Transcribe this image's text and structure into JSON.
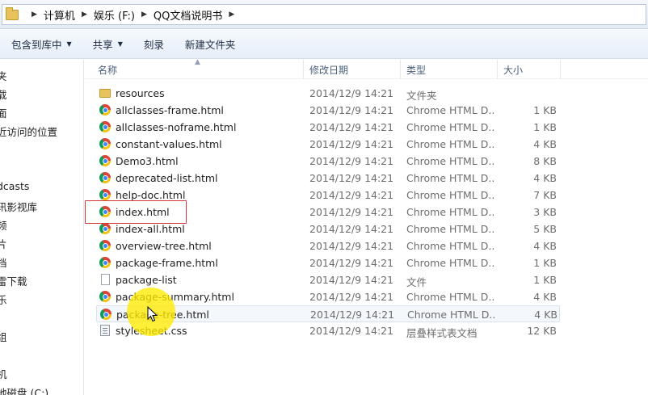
{
  "address_bar": {
    "breadcrumbs": [
      "计算机",
      "娱乐 (F:)",
      "QQ文档说明书"
    ]
  },
  "toolbar": {
    "include_library": "包含到库中",
    "share": "共享",
    "burn": "刻录",
    "new_folder": "新建文件夹"
  },
  "sidebar": {
    "items": [
      "夹",
      "载",
      "面",
      "近访问的位置",
      "dcasts",
      "讯影视库",
      "频",
      "片",
      "档",
      "雷下载",
      "乐",
      "组",
      "机",
      "地磁盘 (C:)"
    ]
  },
  "columns": {
    "name": "名称",
    "date": "修改日期",
    "type": "类型",
    "size": "大小"
  },
  "files": [
    {
      "name": "resources",
      "date": "2014/12/9 14:21",
      "type": "文件夹",
      "size": "",
      "icon": "folder-icon"
    },
    {
      "name": "allclasses-frame.html",
      "date": "2014/12/9 14:21",
      "type": "Chrome HTML D...",
      "size": "1 KB",
      "icon": "chrome-icon"
    },
    {
      "name": "allclasses-noframe.html",
      "date": "2014/12/9 14:21",
      "type": "Chrome HTML D...",
      "size": "1 KB",
      "icon": "chrome-icon"
    },
    {
      "name": "constant-values.html",
      "date": "2014/12/9 14:21",
      "type": "Chrome HTML D...",
      "size": "4 KB",
      "icon": "chrome-icon"
    },
    {
      "name": "Demo3.html",
      "date": "2014/12/9 14:21",
      "type": "Chrome HTML D...",
      "size": "8 KB",
      "icon": "chrome-icon"
    },
    {
      "name": "deprecated-list.html",
      "date": "2014/12/9 14:21",
      "type": "Chrome HTML D...",
      "size": "4 KB",
      "icon": "chrome-icon"
    },
    {
      "name": "help-doc.html",
      "date": "2014/12/9 14:21",
      "type": "Chrome HTML D...",
      "size": "7 KB",
      "icon": "chrome-icon"
    },
    {
      "name": "index.html",
      "date": "2014/12/9 14:21",
      "type": "Chrome HTML D...",
      "size": "3 KB",
      "icon": "chrome-icon"
    },
    {
      "name": "index-all.html",
      "date": "2014/12/9 14:21",
      "type": "Chrome HTML D...",
      "size": "5 KB",
      "icon": "chrome-icon"
    },
    {
      "name": "overview-tree.html",
      "date": "2014/12/9 14:21",
      "type": "Chrome HTML D...",
      "size": "4 KB",
      "icon": "chrome-icon"
    },
    {
      "name": "package-frame.html",
      "date": "2014/12/9 14:21",
      "type": "Chrome HTML D...",
      "size": "1 KB",
      "icon": "chrome-icon"
    },
    {
      "name": "package-list",
      "date": "2014/12/9 14:21",
      "type": "文件",
      "size": "1 KB",
      "icon": "document-icon"
    },
    {
      "name": "package-summary.html",
      "date": "2014/12/9 14:21",
      "type": "Chrome HTML D...",
      "size": "4 KB",
      "icon": "chrome-icon"
    },
    {
      "name": "package-tree.html",
      "date": "2014/12/9 14:21",
      "type": "Chrome HTML D...",
      "size": "4 KB",
      "icon": "chrome-icon"
    },
    {
      "name": "stylesheet.css",
      "date": "2014/12/9 14:21",
      "type": "层叠样式表文档",
      "size": "12 KB",
      "icon": "stylesheet-icon"
    }
  ],
  "colors": {
    "annotation_box": "#d23a3a",
    "cursor_highlight": "#ffeb00"
  }
}
